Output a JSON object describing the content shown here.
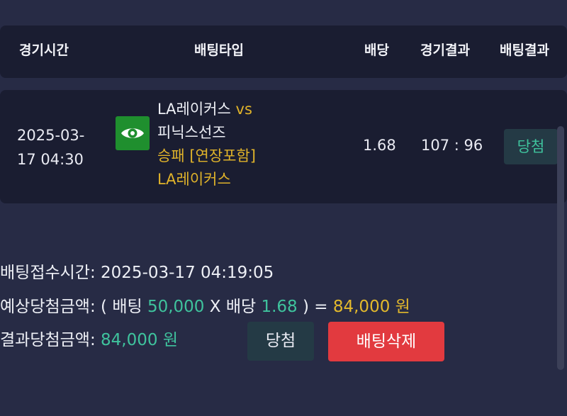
{
  "header": {
    "col_time": "경기시간",
    "col_type": "배팅타입",
    "col_odds": "배당",
    "col_result": "경기결과",
    "col_bet_result": "배팅결과"
  },
  "bet": {
    "time_line1": "2025-03-",
    "time_line2": "17 04:30",
    "icon": "eye-icon",
    "team_home": "LA레이커스",
    "vs": "vs",
    "team_away": "피닉스선즈",
    "market": "승패 [연장포함]",
    "pick": "LA레이커스",
    "odds": "1.68",
    "score": "107 : 96",
    "status": "당첨"
  },
  "info": {
    "received_label": "배팅접수시간:",
    "received_value": "2025-03-17 04:19:05",
    "expected_label": "예상당첨금액:",
    "expected_open": "( 배팅",
    "stake": "50,000",
    "times": "X 배당",
    "expected_odds": "1.68",
    "expected_close": ") =",
    "expected_amount": "84,000 원",
    "result_label": "결과당첨금액:",
    "result_amount": "84,000 원"
  },
  "actions": {
    "win_label": "당첨",
    "delete_label": "배팅삭제"
  },
  "colors": {
    "background": "#272b45",
    "card": "#1a1d31",
    "accent_green": "#3fc39d",
    "accent_gold": "#e0b32a",
    "delete_red": "#e23a3f",
    "icon_green": "#1f8f2e"
  }
}
